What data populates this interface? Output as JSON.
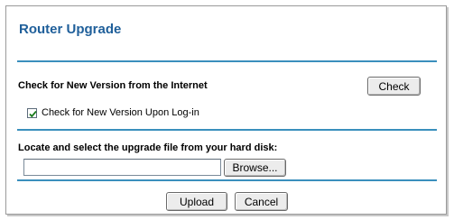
{
  "page": {
    "title": "Router Upgrade"
  },
  "check_section": {
    "heading": "Check for New Version from the Internet",
    "check_button": "Check",
    "auto_check_label": "Check for New Version Upon Log-in",
    "auto_check_checked": true
  },
  "upload_section": {
    "heading": "Locate and select the upgrade file from your hard disk:",
    "file_value": "",
    "browse_button": "Browse..."
  },
  "actions": {
    "upload_button": "Upload",
    "cancel_button": "Cancel"
  },
  "colors": {
    "title": "#1f5f9a",
    "rule": "#3a8fbd"
  }
}
